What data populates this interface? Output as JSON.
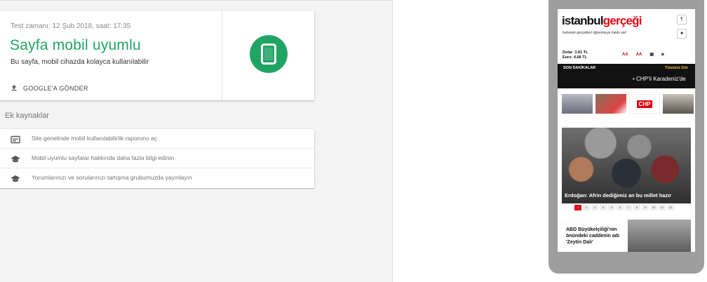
{
  "result": {
    "test_time": "Test zamanı: 12 Şub 2018, saat: 17:35",
    "title": "Sayfa mobil uyumlu",
    "description": "Bu sayfa, mobil cihazda kolayca kullanılabilir",
    "submit_label": "GOOGLE'A GÖNDER",
    "accent_color": "#20a464"
  },
  "resources": {
    "title": "Ek kaynaklar",
    "items": [
      {
        "label": "Site genelinde mobil kullanılabilirlik raporunu aç",
        "icon": "report-icon"
      },
      {
        "label": "Mobil uyumlu sayfalar hakkında daha fazla bilgi edinin",
        "icon": "school-icon"
      },
      {
        "label": "Yorumlarınızı ve sorularınızı tartışma grubumuzda yayınlayın",
        "icon": "school-icon"
      }
    ]
  },
  "preview": {
    "logo_part1": "istanbul",
    "logo_part2": "gerçeği",
    "slogan": "herkesin gerçekleri öğrenmeye hakkı var!",
    "rates": [
      "Dolar: 3.81 TL",
      "Euro: 4,68 TL"
    ],
    "breaking_label": "SON DAKİKALAR",
    "see_all": "Tümünü Gör",
    "ticker": "• CHP'li Karadeniz'de",
    "hero_caption": "Erdoğan: Afrin dediğimiz an bu millet hazır",
    "pager": [
      "1",
      "2",
      "3",
      "4",
      "5",
      "6",
      "7",
      "8",
      "9",
      "10",
      "11",
      "12"
    ],
    "story_headline": "ABD Büyükelçiliği'nin önündeki caddenin adı 'Zeytin Dalı'"
  }
}
